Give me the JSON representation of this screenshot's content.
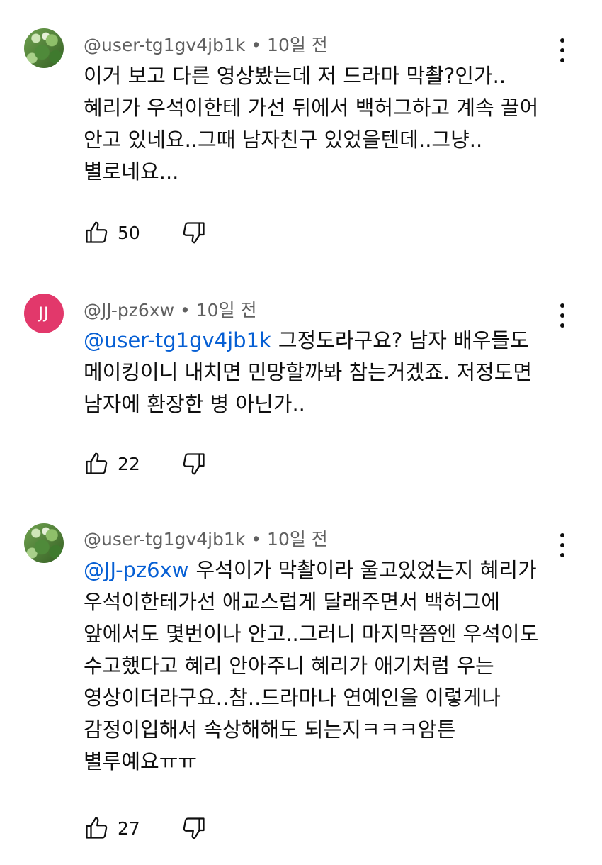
{
  "comments": [
    {
      "author": "@user-tg1gv4jb1k",
      "time": "10일 전",
      "separator": "•",
      "mention": "",
      "text": "이거 보고 다른 영상봤는데 저 드라마 막촬?인가..혜리가 우석이한테 가선 뒤에서 백허그하고 계속 끌어 안고 있네요..그때 남자친구 있었을텐데..그냥..별로네요...",
      "likes": "50",
      "avatar_type": "leaves"
    },
    {
      "author": "@JJ-pz6xw",
      "time": "10일 전",
      "separator": "•",
      "avatar_initials": "JJ",
      "mention": "@user-tg1gv4jb1k",
      "text": "그정도라구요? 남자 배우들도 메이킹이니 내치면 민망할까봐 참는거겠죠. 저정도면 남자에 환장한 병 아닌가..",
      "likes": "22",
      "avatar_type": "initials",
      "avatar_color": "#e2386b"
    },
    {
      "author": "@user-tg1gv4jb1k",
      "time": "10일 전",
      "separator": "•",
      "mention": "@JJ-pz6xw",
      "text": "우석이가 막촬이라 울고있었는지 혜리가 우석이한테가선 애교스럽게 달래주면서 백허그에 앞에서도 몇번이나 안고..그러니 마지막쯤엔 우석이도 수고했다고 혜리 안아주니 혜리가 애기처럼 우는 영상이더라구요..참..드라마나 연예인을 이렇게나 감정이입해서 속상해해도 되는지ㅋㅋㅋ암튼 별루예요ㅠㅠ",
      "likes": "27",
      "avatar_type": "leaves"
    }
  ],
  "icons": {
    "like": "thumbs-up-icon",
    "dislike": "thumbs-down-icon",
    "more": "more-vert-icon"
  },
  "colors": {
    "mention": "#065fd4",
    "meta": "#606060",
    "text": "#0f0f0f"
  }
}
